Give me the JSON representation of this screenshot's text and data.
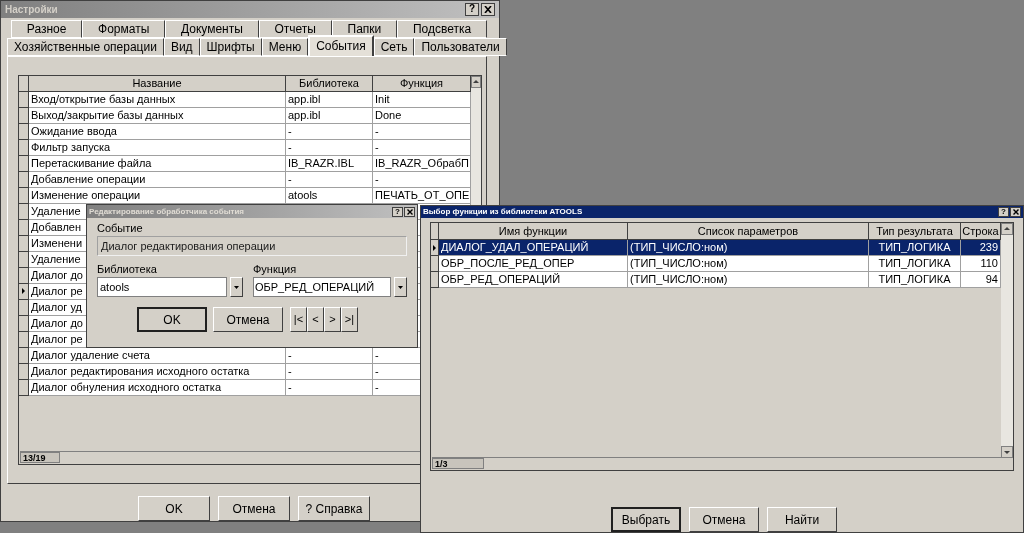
{
  "settings_window": {
    "title": "Настройки",
    "help_button": "?",
    "tab_rows": [
      [
        {
          "label": "Разное",
          "selected": false
        },
        {
          "label": "Форматы",
          "selected": false
        },
        {
          "label": "Документы",
          "selected": false
        },
        {
          "label": "Отчеты",
          "selected": false
        },
        {
          "label": "Папки",
          "selected": false
        },
        {
          "label": "Подсветка",
          "selected": false
        }
      ],
      [
        {
          "label": "Хозяйственные операции",
          "selected": false
        },
        {
          "label": "Вид",
          "selected": false
        },
        {
          "label": "Шрифты",
          "selected": false
        },
        {
          "label": "Меню",
          "selected": false
        },
        {
          "label": "События",
          "selected": true
        },
        {
          "label": "Сеть",
          "selected": false
        },
        {
          "label": "Пользователи",
          "selected": false
        }
      ]
    ],
    "events_table": {
      "columns": [
        "Название",
        "Библиотека",
        "Функция"
      ],
      "rows": [
        {
          "name": "Вход/открытие базы данных",
          "library": "app.ibl",
          "function": "Init",
          "current": false
        },
        {
          "name": "Выход/закрытие базы данных",
          "library": "app.ibl",
          "function": "Done",
          "current": false
        },
        {
          "name": "Ожидание ввода",
          "library": "-",
          "function": "-",
          "current": false
        },
        {
          "name": "Фильтр запуска",
          "library": "-",
          "function": "-",
          "current": false
        },
        {
          "name": "Перетаскивание файла",
          "library": "IB_RAZR.IBL",
          "function": "IB_RAZR_ОбрабП",
          "current": false
        },
        {
          "name": "Добавление операции",
          "library": "-",
          "function": "-",
          "current": false
        },
        {
          "name": "Изменение операции",
          "library": "atools",
          "function": "ПЕЧАТЬ_ОТ_ОПЕ",
          "current": false
        },
        {
          "name": "Удаление",
          "current": false
        },
        {
          "name": "Добавлен",
          "current": false
        },
        {
          "name": "Изменени",
          "current": false
        },
        {
          "name": "Удаление",
          "current": false
        },
        {
          "name": "Диалог до",
          "current": false
        },
        {
          "name": "Диалог ре",
          "current": true
        },
        {
          "name": "Диалог уд",
          "current": false
        },
        {
          "name": "Диалог до",
          "current": false
        },
        {
          "name": "Диалог ре",
          "current": false
        },
        {
          "name": "Диалог удаление счета",
          "library": "-",
          "function": "-",
          "current": false
        },
        {
          "name": "Диалог редактирования исходного остатка",
          "library": "-",
          "function": "-",
          "current": false
        },
        {
          "name": "Диалог обнуления исходного остатка",
          "library": "-",
          "function": "-",
          "current": false
        }
      ],
      "record_counter": "13/19"
    },
    "buttons": [
      "OK",
      "Отмена",
      "? Справка"
    ]
  },
  "edit_dialog": {
    "title": "Редактирование обработчика события",
    "help_button": "?",
    "event_label": "Событие",
    "event_value": "Диалог редактирования операции",
    "library_label": "Библиотека",
    "library_value": "atools",
    "function_label": "Функция",
    "function_value": "ОБР_РЕД_ОПЕРАЦИЙ",
    "buttons": [
      "OK",
      "Отмена"
    ],
    "nav_buttons": [
      "|<",
      "<",
      ">",
      ">|"
    ]
  },
  "function_dialog": {
    "title": "Выбор функции из библиотеки ATOOLS",
    "help_button": "?",
    "columns": [
      "Имя функции",
      "Список параметров",
      "Тип результата",
      "Строка"
    ],
    "rows": [
      {
        "name": "ДИАЛОГ_УДАЛ_ОПЕРАЦИЙ",
        "params": "(ТИП_ЧИСЛО:ном)",
        "result": "ТИП_ЛОГИКА",
        "line": "239",
        "selected": true
      },
      {
        "name": "ОБР_ПОСЛЕ_РЕД_ОПЕР",
        "params": "(ТИП_ЧИСЛО:ном)",
        "result": "ТИП_ЛОГИКА",
        "line": "110",
        "selected": false
      },
      {
        "name": "ОБР_РЕД_ОПЕРАЦИЙ",
        "params": "(ТИП_ЧИСЛО:ном)",
        "result": "ТИП_ЛОГИКА",
        "line": "94",
        "selected": false
      }
    ],
    "record_counter": "1/3",
    "buttons": [
      "Выбрать",
      "Отмена",
      "Найти"
    ]
  }
}
